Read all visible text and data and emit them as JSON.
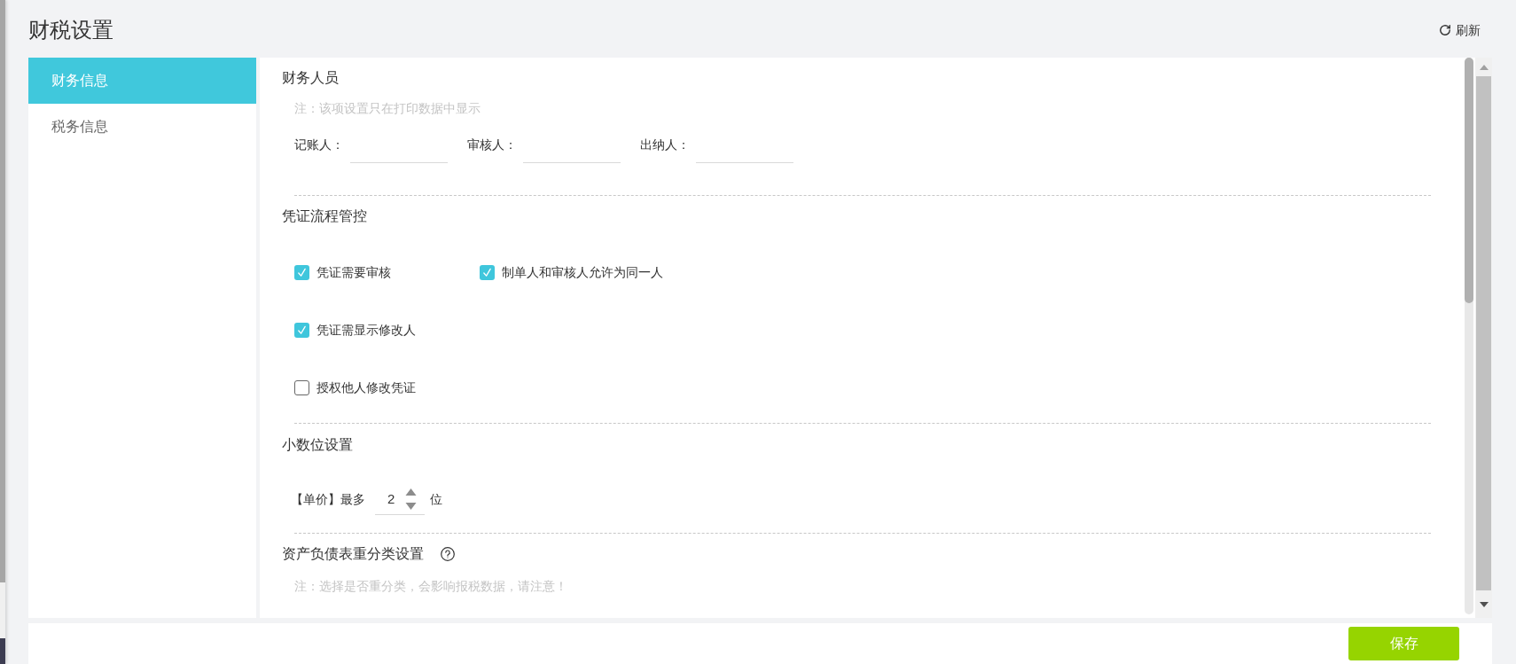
{
  "page": {
    "title": "财税设置",
    "refresh": "刷新"
  },
  "sidebar": {
    "items": [
      {
        "label": "财务信息",
        "selected": true
      },
      {
        "label": "税务信息",
        "selected": false
      }
    ]
  },
  "staff": {
    "heading": "财务人员",
    "note": "注：该项设置只在打印数据中显示",
    "fields": [
      {
        "label": "记账人："
      },
      {
        "label": "审核人："
      },
      {
        "label": "出纳人："
      }
    ]
  },
  "voucher_flow": {
    "heading": "凭证流程管控",
    "rows": [
      {
        "options": [
          {
            "label": "凭证需要审核",
            "checked": true
          },
          {
            "label": "制单人和审核人允许为同一人",
            "checked": true
          }
        ]
      },
      {
        "options": [
          {
            "label": "凭证需显示修改人",
            "checked": true
          }
        ]
      },
      {
        "options": [
          {
            "label": "授权他人修改凭证",
            "checked": false
          }
        ]
      }
    ]
  },
  "decimals": {
    "heading": "小数位设置",
    "prefix": "【单价】最多",
    "value": "2",
    "suffix": "位"
  },
  "reclassification": {
    "heading": "资产负债表重分类设置",
    "note": "注：选择是否重分类，会影响报税数据，请注意！"
  },
  "footer": {
    "save": "保存"
  }
}
